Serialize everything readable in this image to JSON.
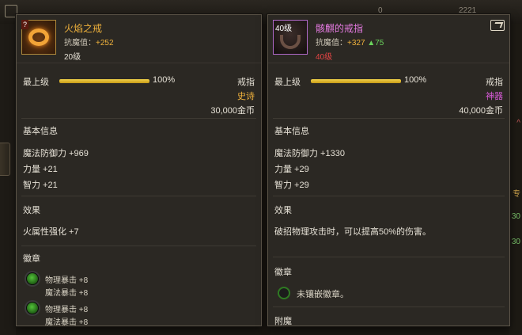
{
  "top_bar": {
    "left_number": "0",
    "right_number": "2221"
  },
  "right_edge": {
    "mark_1": "^",
    "mark_2": "30",
    "mark_3": "专",
    "mark_4": "30"
  },
  "left_item": {
    "name": "火焰之戒",
    "name_color": "#f0b23c",
    "icon": "flame-ring-icon",
    "corner_badge": "?",
    "stat_label": "抗魔值：",
    "stat_value": "+252",
    "level": "20级",
    "level_color": "#e6e1d6",
    "tier_label": "最上级",
    "tier_progress": 100,
    "tier_percent": "100%",
    "slot": "戒指",
    "rarity": "史诗",
    "rarity_color": "#f0b23c",
    "price": "30,000金币",
    "basic_title": "基本信息",
    "basic_stats": [
      "魔法防御力 +969",
      "力量 +21",
      "智力 +21"
    ],
    "effect_title": "效果",
    "effect_text": "火属性强化 +7",
    "emblem_title": "徽章",
    "emblems": [
      {
        "line1": "物理暴击 +8",
        "line2": "魔法暴击 +8"
      },
      {
        "line1": "物理暴击 +8",
        "line2": "魔法暴击 +8"
      }
    ]
  },
  "right_item": {
    "name": "骸麒的戒指",
    "name_color": "#e77be3",
    "icon": "fang-ring-icon",
    "icon_level": "40级",
    "stat_label": "抗魔值：",
    "stat_value": "+327",
    "stat_delta": "▲75",
    "level": "40级",
    "level_color": "#e64545",
    "tier_label": "最上级",
    "tier_progress": 100,
    "tier_percent": "100%",
    "slot": "戒指",
    "rarity": "神器",
    "rarity_color": "#d65ad6",
    "price": "40,000金币",
    "basic_title": "基本信息",
    "basic_stats": [
      "魔法防御力 +1330",
      "力量 +29",
      "智力 +29"
    ],
    "effect_title": "效果",
    "effect_text": "破招物理攻击时，可以提高50%的伤害。",
    "emblem_title": "徽章",
    "emblem_empty": "未镶嵌徽章。",
    "next_section": "附魔"
  }
}
